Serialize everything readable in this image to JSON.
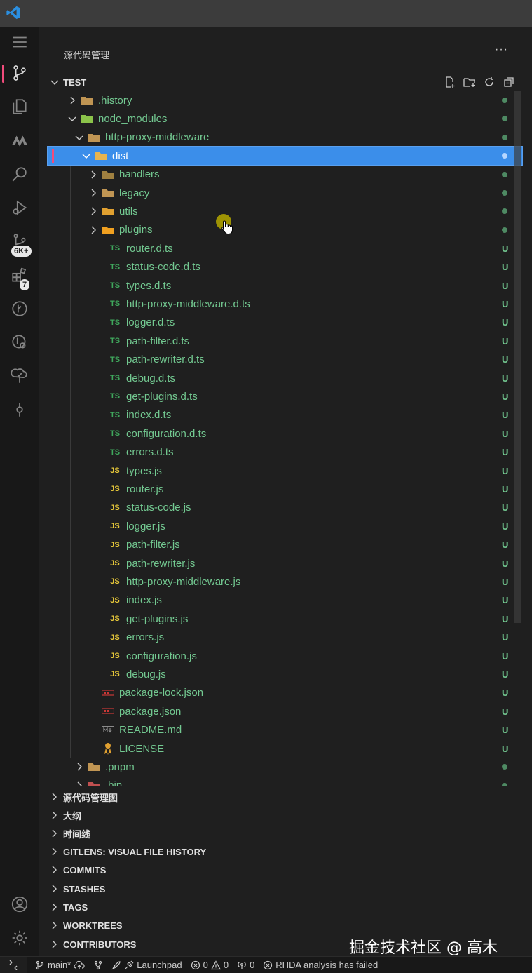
{
  "view": {
    "title": "源代码管理",
    "more": "···"
  },
  "section": {
    "title": "TEST"
  },
  "activity": {
    "badge_scm": "6K+",
    "badge_ext": "7"
  },
  "tree": [
    {
      "label": ".history",
      "icon": "folder-icon",
      "chev": "right",
      "status": "dot"
    },
    {
      "label": "node_modules",
      "icon": "folder-node-icon",
      "chev": "down",
      "status": "dot"
    },
    {
      "label": "http-proxy-middleware",
      "icon": "folder-icon",
      "chev": "down",
      "status": "dot"
    },
    {
      "label": "dist",
      "icon": "folder-dist-icon",
      "chev": "down",
      "status": "dot",
      "selected": true
    },
    {
      "label": "handlers",
      "icon": "folder-handlers-icon",
      "chev": "right",
      "status": "dot"
    },
    {
      "label": "legacy",
      "icon": "folder-icon",
      "chev": "right",
      "status": "dot"
    },
    {
      "label": "utils",
      "icon": "folder-utils-icon",
      "chev": "right",
      "status": "dot"
    },
    {
      "label": "plugins",
      "icon": "folder-plugins-icon",
      "chev": "right",
      "status": "dot"
    },
    {
      "label": "router.d.ts",
      "icon": "TS",
      "status": "U"
    },
    {
      "label": "status-code.d.ts",
      "icon": "TS",
      "status": "U"
    },
    {
      "label": "types.d.ts",
      "icon": "TS",
      "status": "U"
    },
    {
      "label": "http-proxy-middleware.d.ts",
      "icon": "TS",
      "status": "U"
    },
    {
      "label": "logger.d.ts",
      "icon": "TS",
      "status": "U"
    },
    {
      "label": "path-filter.d.ts",
      "icon": "TS",
      "status": "U"
    },
    {
      "label": "path-rewriter.d.ts",
      "icon": "TS",
      "status": "U"
    },
    {
      "label": "debug.d.ts",
      "icon": "TS",
      "status": "U"
    },
    {
      "label": "get-plugins.d.ts",
      "icon": "TS",
      "status": "U"
    },
    {
      "label": "index.d.ts",
      "icon": "TS",
      "status": "U"
    },
    {
      "label": "configuration.d.ts",
      "icon": "TS",
      "status": "U"
    },
    {
      "label": "errors.d.ts",
      "icon": "TS",
      "status": "U"
    },
    {
      "label": "types.js",
      "icon": "JS",
      "status": "U"
    },
    {
      "label": "router.js",
      "icon": "JS",
      "status": "U"
    },
    {
      "label": "status-code.js",
      "icon": "JS",
      "status": "U"
    },
    {
      "label": "logger.js",
      "icon": "JS",
      "status": "U"
    },
    {
      "label": "path-filter.js",
      "icon": "JS",
      "status": "U"
    },
    {
      "label": "path-rewriter.js",
      "icon": "JS",
      "status": "U"
    },
    {
      "label": "http-proxy-middleware.js",
      "icon": "JS",
      "status": "U"
    },
    {
      "label": "index.js",
      "icon": "JS",
      "status": "U"
    },
    {
      "label": "get-plugins.js",
      "icon": "JS",
      "status": "U"
    },
    {
      "label": "errors.js",
      "icon": "JS",
      "status": "U"
    },
    {
      "label": "configuration.js",
      "icon": "JS",
      "status": "U"
    },
    {
      "label": "debug.js",
      "icon": "JS",
      "status": "U"
    },
    {
      "label": "package-lock.json",
      "icon": "npm-icon",
      "status": "U"
    },
    {
      "label": "package.json",
      "icon": "npm-icon",
      "status": "U"
    },
    {
      "label": "README.md",
      "icon": "markdown-icon",
      "status": "U"
    },
    {
      "label": "LICENSE",
      "icon": "license-icon",
      "status": "U"
    },
    {
      "label": ".pnpm",
      "icon": "folder-icon",
      "chev": "right",
      "status": "dot"
    },
    {
      "label": ".bin",
      "icon": "folder-bin-icon",
      "chev": "right",
      "status": "dot"
    }
  ],
  "panels": [
    "源代码管理图",
    "大纲",
    "时间线",
    "GITLENS: VISUAL FILE HISTORY",
    "COMMITS",
    "STASHES",
    "TAGS",
    "WORKTREES",
    "CONTRIBUTORS"
  ],
  "status": {
    "branch": "main*",
    "launchpad": "Launchpad",
    "errors": "0",
    "warnings": "0",
    "ports": "0",
    "rhda": "RHDA analysis has failed"
  },
  "watermark": "掘金技术社区 @ 高木",
  "colors": {
    "accent": "#3b8eea",
    "untracked": "#73c991",
    "ts": "#3fa75c",
    "js": "#e8c93a",
    "activeIndicator": "#f14c7c"
  }
}
